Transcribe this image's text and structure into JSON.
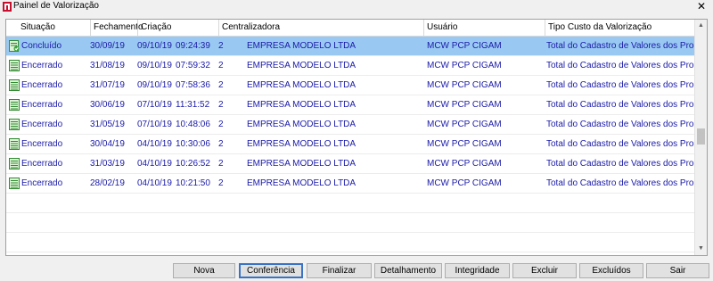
{
  "window": {
    "title": "Painel de Valorização",
    "close_glyph": "✕"
  },
  "grid": {
    "columns": [
      "Situação",
      "Fechamento",
      "Criação",
      "Centralizadora",
      "Usuário",
      "Tipo Custo da Valorização"
    ],
    "rows": [
      {
        "icon": "document-check-icon",
        "situacao": "Concluído",
        "fechamento": "30/09/19",
        "criacao_data": "09/10/19",
        "criacao_hora": "09:24:39",
        "centralizadora_cod": "2",
        "centralizadora_nome": "EMPRESA MODELO LTDA",
        "usuario": "MCW  PCP CIGAM",
        "tipo_custo": "Total do Cadastro de Valores dos Processos",
        "selected": true
      },
      {
        "icon": "document-icon",
        "situacao": "Encerrado",
        "fechamento": "31/08/19",
        "criacao_data": "09/10/19",
        "criacao_hora": "07:59:32",
        "centralizadora_cod": "2",
        "centralizadora_nome": "EMPRESA MODELO LTDA",
        "usuario": "MCW  PCP CIGAM",
        "tipo_custo": "Total do Cadastro de Valores dos Processos",
        "selected": false
      },
      {
        "icon": "document-icon",
        "situacao": "Encerrado",
        "fechamento": "31/07/19",
        "criacao_data": "09/10/19",
        "criacao_hora": "07:58:36",
        "centralizadora_cod": "2",
        "centralizadora_nome": "EMPRESA MODELO LTDA",
        "usuario": "MCW  PCP CIGAM",
        "tipo_custo": "Total do Cadastro de Valores dos Processos",
        "selected": false
      },
      {
        "icon": "document-icon",
        "situacao": "Encerrado",
        "fechamento": "30/06/19",
        "criacao_data": "07/10/19",
        "criacao_hora": "11:31:52",
        "centralizadora_cod": "2",
        "centralizadora_nome": "EMPRESA MODELO LTDA",
        "usuario": "MCW  PCP CIGAM",
        "tipo_custo": "Total do Cadastro de Valores dos Processos",
        "selected": false
      },
      {
        "icon": "document-icon",
        "situacao": "Encerrado",
        "fechamento": "31/05/19",
        "criacao_data": "07/10/19",
        "criacao_hora": "10:48:06",
        "centralizadora_cod": "2",
        "centralizadora_nome": "EMPRESA MODELO LTDA",
        "usuario": "MCW  PCP CIGAM",
        "tipo_custo": "Total do Cadastro de Valores dos Processos",
        "selected": false
      },
      {
        "icon": "document-icon",
        "situacao": "Encerrado",
        "fechamento": "30/04/19",
        "criacao_data": "04/10/19",
        "criacao_hora": "10:30:06",
        "centralizadora_cod": "2",
        "centralizadora_nome": "EMPRESA MODELO LTDA",
        "usuario": "MCW  PCP CIGAM",
        "tipo_custo": "Total do Cadastro de Valores dos Processos",
        "selected": false
      },
      {
        "icon": "document-icon",
        "situacao": "Encerrado",
        "fechamento": "31/03/19",
        "criacao_data": "04/10/19",
        "criacao_hora": "10:26:52",
        "centralizadora_cod": "2",
        "centralizadora_nome": "EMPRESA MODELO LTDA",
        "usuario": "MCW  PCP CIGAM",
        "tipo_custo": "Total do Cadastro de Valores dos Processos",
        "selected": false
      },
      {
        "icon": "document-icon",
        "situacao": "Encerrado",
        "fechamento": "28/02/19",
        "criacao_data": "04/10/19",
        "criacao_hora": "10:21:50",
        "centralizadora_cod": "2",
        "centralizadora_nome": "EMPRESA MODELO LTDA",
        "usuario": "MCW  PCP CIGAM",
        "tipo_custo": "Total do Cadastro de Valores dos Processos",
        "selected": false
      }
    ]
  },
  "buttons": {
    "nova": "Nova",
    "conferencia": "Conferência",
    "finalizar": "Finalizar",
    "detalhamento": "Detalhamento",
    "integridade": "Integridade",
    "excluir": "Excluir",
    "excluidos": "Excluídos",
    "sair": "Sair"
  },
  "colors": {
    "selection": "#99c9f3",
    "row_text": "#1a1aa8",
    "focus_border": "#3a73c4"
  }
}
